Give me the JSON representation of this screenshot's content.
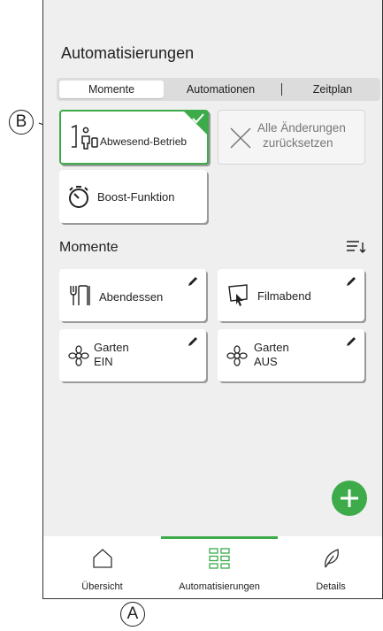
{
  "screen": {
    "title": "Automatisierungen",
    "segments": [
      "Momente",
      "Automationen",
      "Zeitplan"
    ],
    "active_segment": "Momente"
  },
  "quick_actions": {
    "away_mode": {
      "label": "Abwesend-Betrieb",
      "selected": true,
      "icon": "away-person-icon"
    },
    "reset": {
      "line1": "Alle Änderungen",
      "line2": "zurücksetzen",
      "icon": "x-icon"
    },
    "boost": {
      "label": "Boost-Funktion",
      "icon": "timer-icon"
    }
  },
  "moments": {
    "section_title": "Momente",
    "items": [
      {
        "line1": "Abendessen",
        "line2": "",
        "icon": "dinner-cutlery-icon"
      },
      {
        "line1": "Filmabend",
        "line2": "",
        "icon": "movie-screen-icon"
      },
      {
        "line1": "Garten",
        "line2": "EIN",
        "icon": "flower-icon"
      },
      {
        "line1": "Garten",
        "line2": "AUS",
        "icon": "flower-icon"
      }
    ]
  },
  "nav": {
    "tabs": [
      {
        "label": "Übersicht",
        "icon": "home-icon"
      },
      {
        "label": "Automatisierungen",
        "icon": "grid-icon"
      },
      {
        "label": "Details",
        "icon": "leaf-icon"
      }
    ],
    "active": "Automatisierungen"
  },
  "callouts": {
    "a": "A",
    "b": "B"
  },
  "colors": {
    "accent": "#3dab4a",
    "background": "#efefef",
    "tile": "#ffffff"
  }
}
